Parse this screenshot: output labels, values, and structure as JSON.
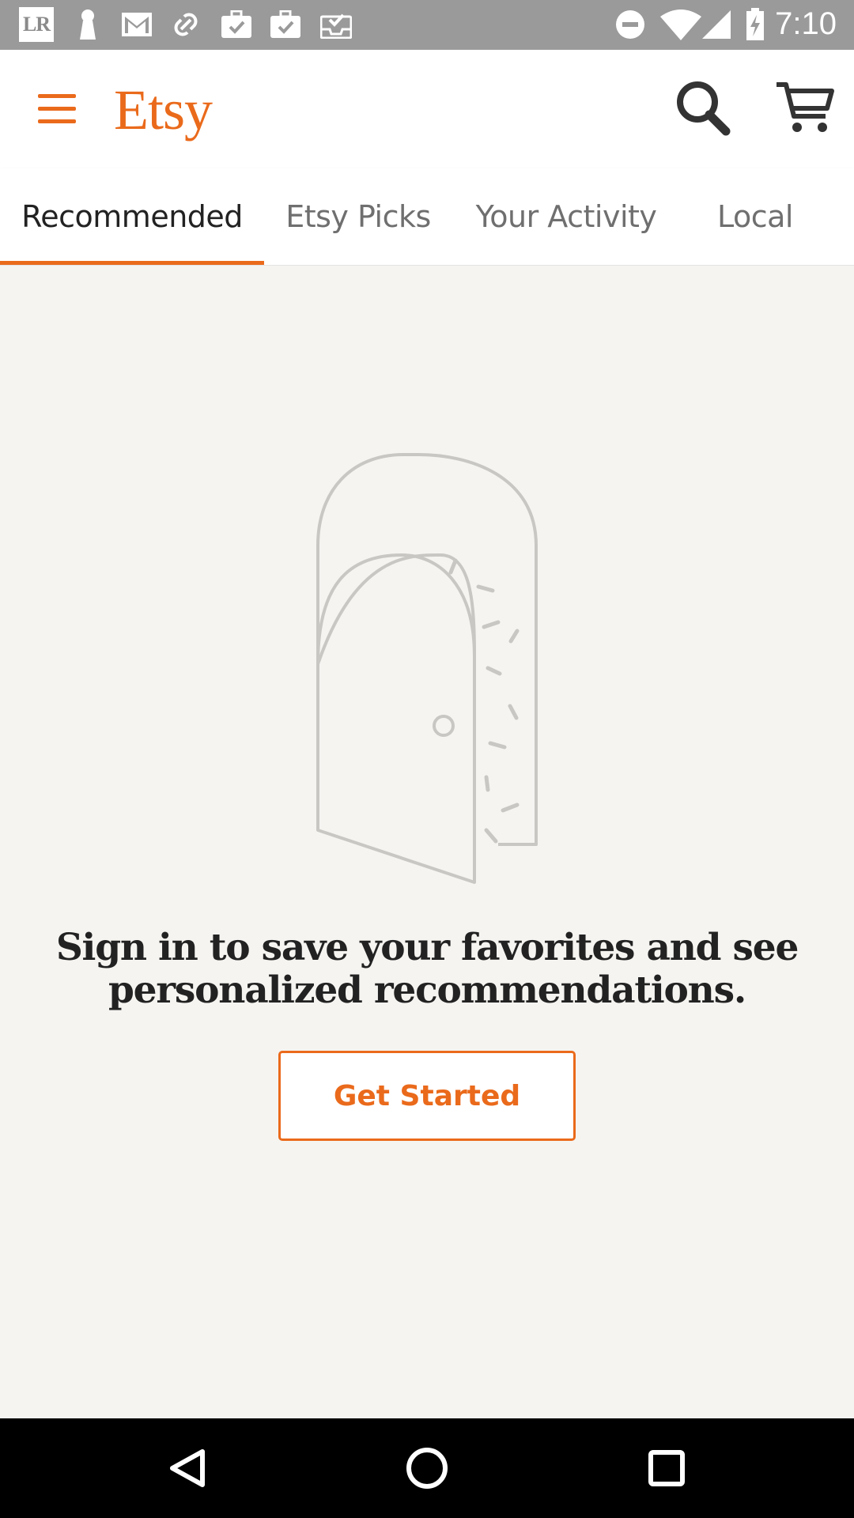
{
  "status_bar": {
    "time": "7:10",
    "left_icons": [
      "lr-app-icon",
      "keyhole-icon",
      "gmail-icon",
      "link-icon",
      "briefcase-check-icon",
      "briefcase-check-icon",
      "inbox-check-icon"
    ],
    "right_icons": [
      "do-not-disturb-icon",
      "wifi-icon",
      "signal-icon",
      "battery-charging-icon"
    ],
    "lr_label": "LR"
  },
  "app_bar": {
    "logo_text": "Etsy",
    "menu_icon": "hamburger-menu-icon",
    "search_icon": "search-icon",
    "cart_icon": "cart-icon",
    "accent_color": "#ea6a1b"
  },
  "tabs": [
    {
      "label": "Recommended",
      "active": true
    },
    {
      "label": "Etsy Picks",
      "active": false
    },
    {
      "label": "Your Activity",
      "active": false
    },
    {
      "label": "Local",
      "active": false
    }
  ],
  "content": {
    "illustration": "open-door-icon",
    "message_line1": "Sign in to save your favorites and see",
    "message_line2": "personalized recommendations.",
    "button_label": "Get Started"
  },
  "nav_bar": {
    "back_icon": "back-triangle-icon",
    "home_icon": "home-circle-icon",
    "recents_icon": "recents-square-icon"
  }
}
